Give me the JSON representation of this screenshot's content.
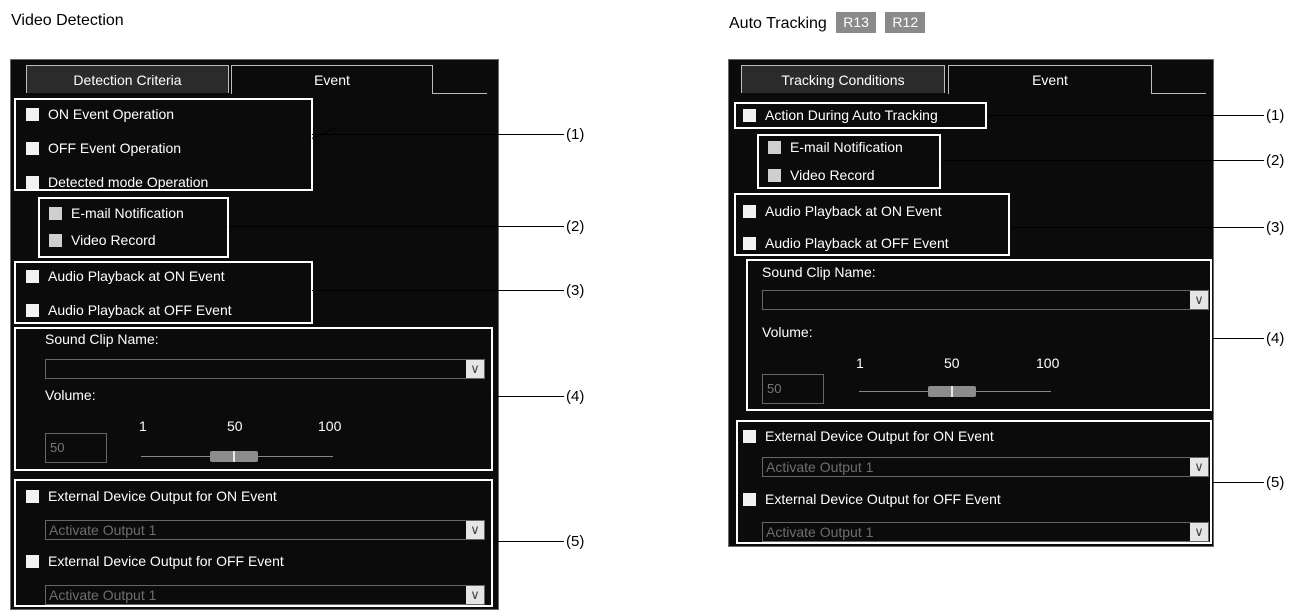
{
  "left": {
    "title": "Video Detection",
    "tabs": [
      "Detection Criteria",
      "Event"
    ],
    "checkboxes": {
      "on_event": "ON Event Operation",
      "off_event": "OFF Event Operation",
      "detected_mode": "Detected mode Operation",
      "email": "E-mail Notification",
      "video_record": "Video Record",
      "audio_on": "Audio Playback at ON Event",
      "audio_off": "Audio Playback at OFF Event",
      "ext_on": "External Device Output for ON Event",
      "ext_off": "External Device Output for OFF Event"
    },
    "sound_clip_label": "Sound Clip Name:",
    "sound_clip_value": "",
    "volume_label": "Volume:",
    "volume_value": "50",
    "volume_ticks": [
      "1",
      "50",
      "100"
    ],
    "ext_on_select": "Activate Output 1",
    "ext_off_select": "Activate Output 1",
    "callouts": [
      "(1)",
      "(2)",
      "(3)",
      "(4)",
      "(5)"
    ]
  },
  "right": {
    "title": "Auto Tracking",
    "badges": [
      "R13",
      "R12"
    ],
    "tabs": [
      "Tracking Conditions",
      "Event"
    ],
    "checkboxes": {
      "action_during": "Action During Auto Tracking",
      "email": "E-mail Notification",
      "video_record": "Video Record",
      "audio_on": "Audio Playback at ON Event",
      "audio_off": "Audio Playback at OFF Event",
      "ext_on": "External Device Output for ON Event",
      "ext_off": "External Device Output for OFF Event"
    },
    "sound_clip_label": "Sound Clip Name:",
    "sound_clip_value": "",
    "volume_label": "Volume:",
    "volume_value": "50",
    "volume_ticks": [
      "1",
      "50",
      "100"
    ],
    "ext_on_select": "Activate Output 1",
    "ext_off_select": "Activate Output 1",
    "callouts": [
      "(1)",
      "(2)",
      "(3)",
      "(4)",
      "(5)"
    ]
  },
  "icons": {
    "dropdown_arrow": "chevron-down-icon",
    "checkbox": "checkbox-icon"
  },
  "colors": {
    "panel_bg": "#0b0b0b",
    "badge_bg": "#8a8a8a",
    "highlight": "#ffffff"
  }
}
